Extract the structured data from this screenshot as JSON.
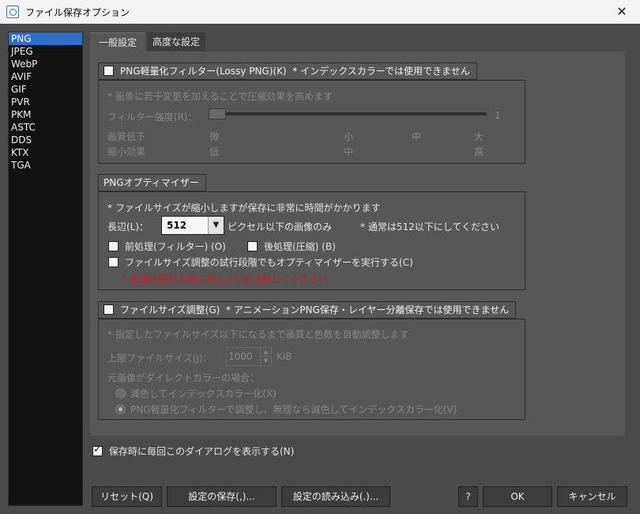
{
  "window": {
    "title": "ファイル保存オプション",
    "close": "✕"
  },
  "formats": [
    "PNG",
    "JPEG",
    "WebP",
    "AVIF",
    "GIF",
    "PVR",
    "PKM",
    "ASTC",
    "DDS",
    "KTX",
    "TGA"
  ],
  "tabs": {
    "general": "一般設定",
    "advanced": "高度な設定"
  },
  "lossy": {
    "title": "PNG軽量化フィルター(Lossy PNG)(K)",
    "note": "* インデックスカラーでは使用できません",
    "desc": "* 画像に若干変更を加えることで圧縮効果を高めます",
    "strength_label": "フィルター強度(R)：",
    "strength_value": "1",
    "row1_label": "画質低下",
    "row1_values": [
      "微",
      "小",
      "中",
      "大"
    ],
    "row2_label": "縮小効果",
    "row2_values": [
      "低",
      "中",
      "高"
    ]
  },
  "optimizer": {
    "title": "PNGオプティマイザー",
    "desc": "* ファイルサイズが縮小しますが保存に非常に時間がかかります",
    "long_side_label": "長辺(L)：",
    "long_side_value": "512",
    "long_side_suffix": "ピクセル以下の画像のみ",
    "long_side_note": "* 通常は512以下にしてください",
    "pre_filter": "前処理(フィルター) (O)",
    "post_compress": "後処理(圧縮) (B)",
    "run_in_trial": "ファイルサイズ調整の試行段階でもオプティマイザーを実行する(C)",
    "warning": "* 処理時間が大幅に増えるため注意してください"
  },
  "filesize": {
    "title": "ファイルサイズ調整(G)",
    "note": "* アニメーションPNG保存・レイヤー分離保存では使用できません",
    "desc": "* 指定したファイルサイズ以下になるまで画質と色数を自動調整します",
    "limit_label": "上限ファイルサイズ(J)：",
    "limit_value": "1000",
    "limit_unit": "KiB",
    "direct_color_label": "元画像がダイレクトカラーの場合：",
    "option1": "減色してインデックスカラー化(X)",
    "option2": "PNG軽量化フィルターで調整し、無理なら減色してインデックスカラー化(V)"
  },
  "show_dialog": "保存時に毎回このダイアログを表示する(N)",
  "buttons": {
    "reset": "リセット(Q)",
    "save_settings": "設定の保存(,)...",
    "load_settings": "設定の読み込み(.)...",
    "help": "?",
    "ok": "OK",
    "cancel": "キャンセル"
  }
}
